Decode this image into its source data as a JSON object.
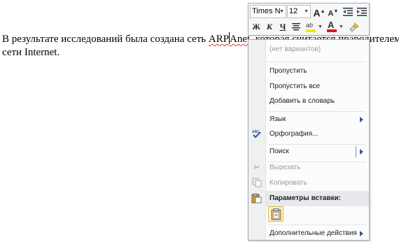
{
  "document": {
    "line1_before": "В результате исследований была создана сеть ",
    "misspelled_part1": "ARP",
    "misspelled_part2": "Anet",
    "line1_after": ", которая считается прародителем",
    "line2": "сети Internet."
  },
  "mini_toolbar": {
    "font_name": "Times N",
    "font_size": "12",
    "grow_font_label": "A",
    "shrink_font_label": "A",
    "bold_label": "Ж",
    "italic_label": "К",
    "underline_label": "Ч",
    "highlight_label": "ab",
    "font_color_label": "A",
    "highlight_color": "#f5e50f",
    "font_color": "#e0161b"
  },
  "context_menu": {
    "no_suggestions": "(нет вариантов)",
    "ignore": "Пропустить",
    "ignore_all": "Пропустить все",
    "add_to_dictionary": "Добавить в словарь",
    "language": "Язык",
    "spelling": "Орфография...",
    "search": "Поиск",
    "cut": "Вырезать",
    "copy": "Копировать",
    "paste_options": "Параметры вставки:",
    "more_actions": "Дополнительные действия"
  },
  "icons": {
    "spelling": "spelling-check-icon",
    "cut": "scissors-icon",
    "copy": "copy-icon",
    "paste": "paste-icon",
    "paste_keep_text": "paste-keep-text-only-icon"
  },
  "colors": {
    "accent_arrow": "#2b5797",
    "squiggle": "#e53935"
  }
}
